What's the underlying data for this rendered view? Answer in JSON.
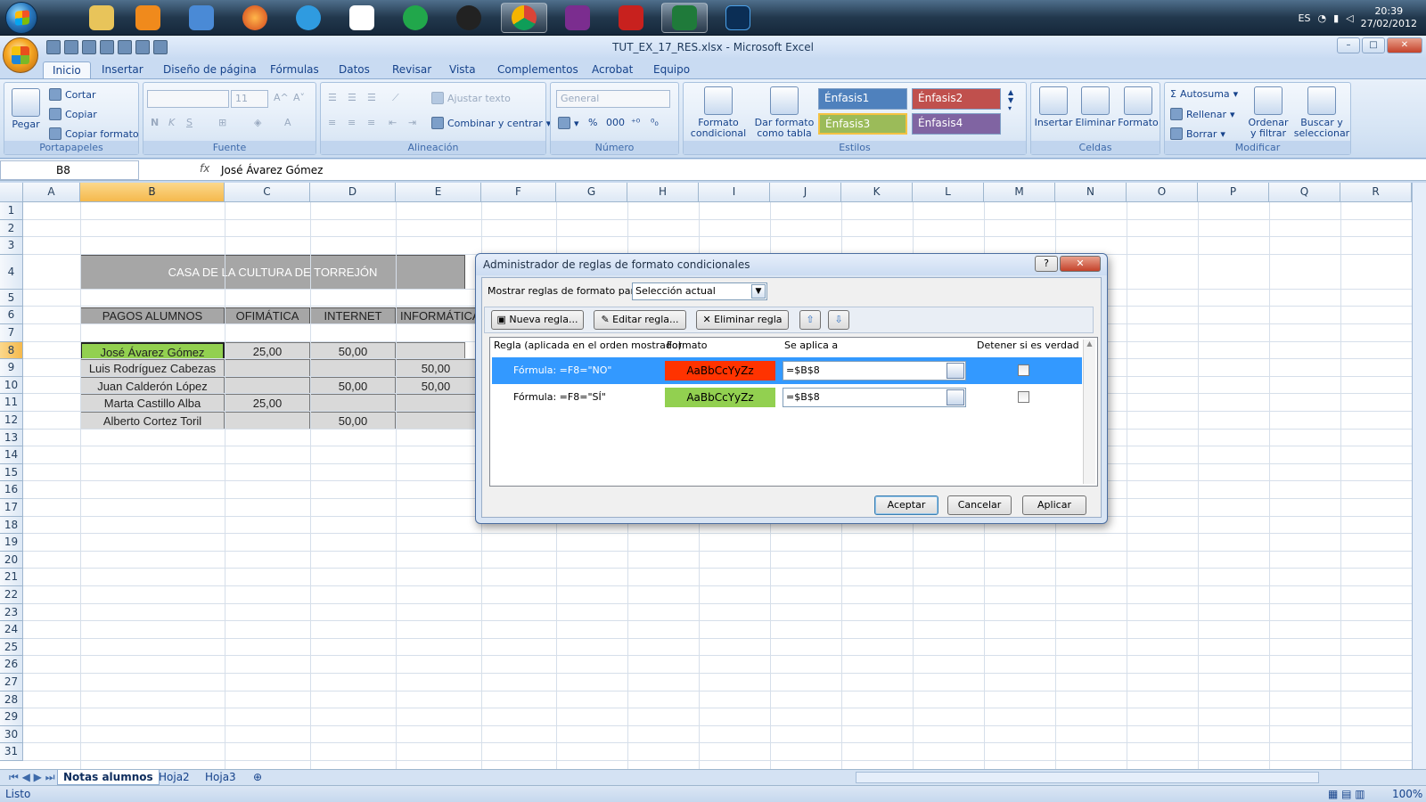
{
  "taskbar": {
    "clock_time": "20:39",
    "clock_date": "27/02/2012",
    "lang": "ES"
  },
  "window": {
    "title": "TUT_EX_17_RES.xlsx - Microsoft Excel"
  },
  "ribbon_tabs": [
    "Inicio",
    "Insertar",
    "Diseño de página",
    "Fórmulas",
    "Datos",
    "Revisar",
    "Vista",
    "Complementos",
    "Acrobat",
    "Equipo"
  ],
  "ribbon": {
    "pegar": "Pegar",
    "cortar": "Cortar",
    "copiar": "Copiar",
    "copiar_formato": "Copiar formato",
    "portapapeles": "Portapapeles",
    "font_size": "11",
    "fuente": "Fuente",
    "bold": "N",
    "italic": "K",
    "underline": "S",
    "font_color": "A",
    "ajustar": "Ajustar texto",
    "combinar": "Combinar y centrar",
    "alineacion": "Alineación",
    "numfmt": "General",
    "percent": "%",
    "thousands": "000",
    "numero": "Número",
    "formato_cond": "Formato condicional",
    "dar_formato": "Dar formato como tabla",
    "estilos": "Estilos",
    "enfasis1": "Énfasis1",
    "enfasis2": "Énfasis2",
    "enfasis3": "Énfasis3",
    "enfasis4": "Énfasis4",
    "insertar": "Insertar",
    "eliminar": "Eliminar",
    "formato": "Formato",
    "celdas": "Celdas",
    "autosuma": "Autosuma",
    "rellenar": "Rellenar",
    "borrar": "Borrar",
    "ordenar": "Ordenar y filtrar",
    "buscar": "Buscar y seleccionar",
    "modificar": "Modificar"
  },
  "formula_bar": {
    "name_box": "B8",
    "fx": "fx",
    "content": "José Ávarez Gómez"
  },
  "sheet": {
    "columns": [
      "A",
      "B",
      "C",
      "D",
      "E",
      "F",
      "G",
      "H",
      "I",
      "J",
      "K",
      "L",
      "M",
      "N",
      "O",
      "P",
      "Q",
      "R"
    ],
    "rows": [
      "1",
      "2",
      "3",
      "4",
      "5",
      "6",
      "7",
      "8",
      "9",
      "10",
      "11",
      "12",
      "13",
      "14",
      "15",
      "16",
      "17",
      "18",
      "19",
      "20",
      "21",
      "22",
      "23",
      "24",
      "25",
      "26",
      "27",
      "28",
      "29",
      "30",
      "31"
    ],
    "title": "CASA DE LA CULTURA DE TORREJÓN",
    "headers": [
      "PAGOS ALUMNOS",
      "OFIMÁTICA",
      "INTERNET",
      "INFORMÁTICA"
    ],
    "data": [
      [
        "José Ávarez Gómez",
        "25,00",
        "50,00",
        ""
      ],
      [
        "Luis Rodríguez Cabezas",
        "",
        "",
        "50,00"
      ],
      [
        "Juan Calderón López",
        "",
        "50,00",
        "50,00"
      ],
      [
        "Marta Castillo Alba",
        "25,00",
        "",
        ""
      ],
      [
        "Alberto Cortez Toril",
        "",
        "50,00",
        ""
      ]
    ]
  },
  "sheet_tabs": [
    "Notas alumnos",
    "Hoja2",
    "Hoja3"
  ],
  "status": {
    "text": "Listo",
    "zoom": "100%"
  },
  "dialog": {
    "title": "Administrador de reglas de formato condicionales",
    "help": "?",
    "close": "✕",
    "show_label": "Mostrar reglas de formato para:",
    "show_value": "Selección actual",
    "btn_new": "Nueva regla...",
    "btn_edit": "Editar regla...",
    "btn_delete": "Eliminar regla",
    "col_rule": "Regla (aplicada en el orden mostrado)",
    "col_format": "Formato",
    "col_applies": "Se aplica a",
    "col_stop": "Detener si es verdad",
    "rules": [
      {
        "rule": "Fórmula: =F8=\"NO\"",
        "preview": "AaBbCcYyZz",
        "applies": "=$B$8",
        "color": "#ff3300"
      },
      {
        "rule": "Fórmula: =F8=\"SÍ\"",
        "preview": "AaBbCcYyZz",
        "applies": "=$B$8",
        "color": "#92d050"
      }
    ],
    "ok": "Aceptar",
    "cancel": "Cancelar",
    "apply": "Aplicar"
  }
}
